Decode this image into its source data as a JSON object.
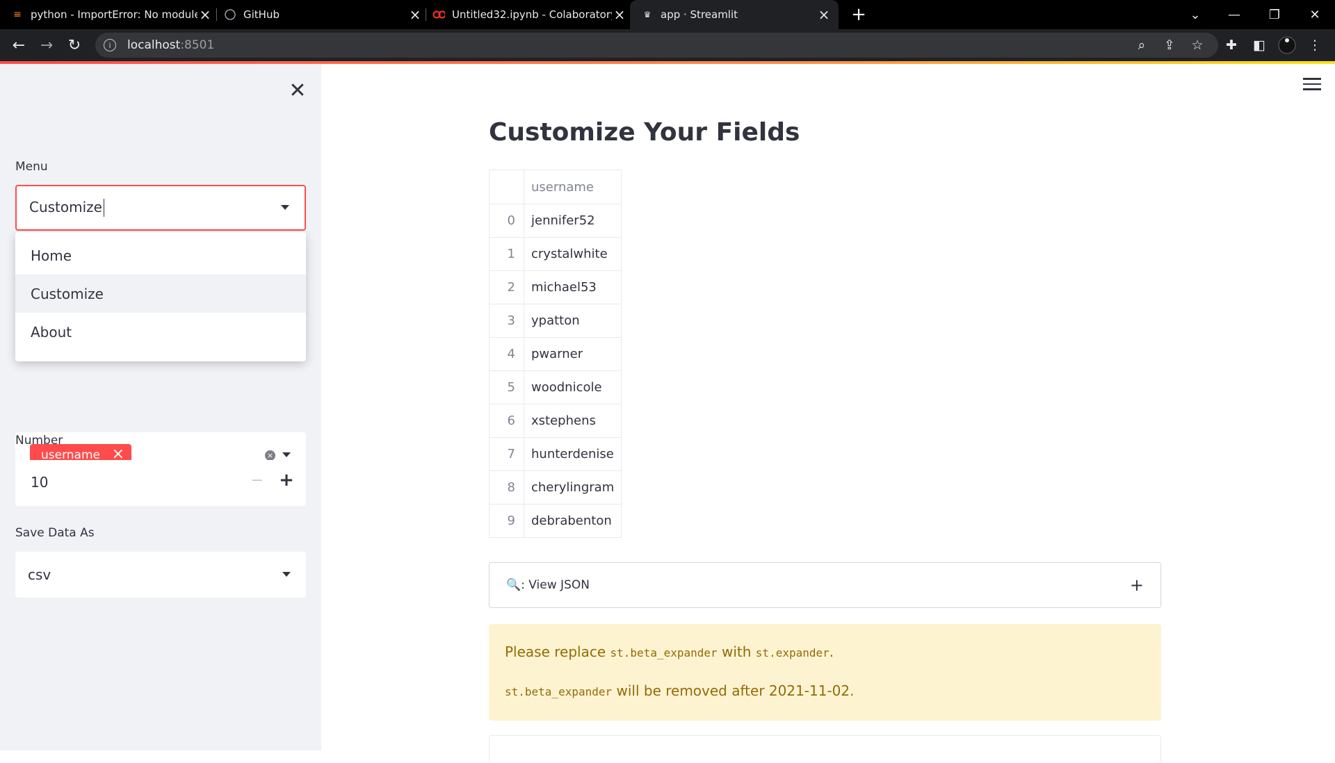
{
  "browser": {
    "tabs": [
      {
        "title": "python - ImportError: No module",
        "icon": "stackoverflow-icon"
      },
      {
        "title": "GitHub",
        "icon": "github-icon"
      },
      {
        "title": "Untitled32.ipynb - Colaboratory",
        "icon": "colab-icon"
      },
      {
        "title": "app · Streamlit",
        "icon": "streamlit-icon"
      }
    ],
    "url_host": "localhost",
    "url_port": ":8501"
  },
  "sidebar": {
    "menu_label": "Menu",
    "menu_value": "Customize",
    "menu_options": [
      "Home",
      "Customize",
      "About"
    ],
    "multiselect_chip": "username",
    "number_label": "Number",
    "number_value": "10",
    "save_label": "Save Data As",
    "save_value": "csv"
  },
  "main": {
    "title": "Customize Your Fields",
    "table": {
      "header": "username",
      "rows": [
        {
          "idx": "0",
          "username": "jennifer52"
        },
        {
          "idx": "1",
          "username": "crystalwhite"
        },
        {
          "idx": "2",
          "username": "michael53"
        },
        {
          "idx": "3",
          "username": "ypatton"
        },
        {
          "idx": "4",
          "username": "pwarner"
        },
        {
          "idx": "5",
          "username": "woodnicole"
        },
        {
          "idx": "6",
          "username": "xstephens"
        },
        {
          "idx": "7",
          "username": "hunterdenise"
        },
        {
          "idx": "8",
          "username": "cherylingram"
        },
        {
          "idx": "9",
          "username": "debrabenton"
        }
      ]
    },
    "expander_icon": "🔍",
    "expander_label": ": View JSON",
    "warning": {
      "l1_a": "Please replace ",
      "l1_code1": "st.beta_expander",
      "l1_b": " with ",
      "l1_code2": "st.expander",
      "l1_c": ".",
      "l2_code": "st.beta_expander",
      "l2_b": " will be removed after 2021-11-02."
    }
  },
  "colors": {
    "accent": "#ff4b4b",
    "sidebar_bg": "#f0f2f6",
    "warning_bg": "#fdf3d1",
    "warning_text": "#926c05"
  }
}
